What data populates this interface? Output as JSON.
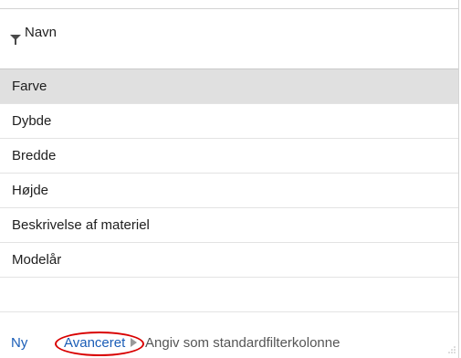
{
  "header": {
    "column_label": "Navn",
    "filter_icon": "filter-funnel-icon"
  },
  "list": {
    "items": [
      {
        "label": "Farve",
        "selected": true
      },
      {
        "label": "Dybde",
        "selected": false
      },
      {
        "label": "Bredde",
        "selected": false
      },
      {
        "label": "Højde",
        "selected": false
      },
      {
        "label": "Beskrivelse af materiel",
        "selected": false
      },
      {
        "label": "Modelår",
        "selected": false
      }
    ]
  },
  "footer": {
    "new_label": "Ny",
    "advanced_label": "Avanceret",
    "set_default_label": "Angiv som standardfilterkolonne",
    "advanced_icon": "triangle-arrow-icon"
  },
  "colors": {
    "link": "#1a5db7",
    "highlight": "#d90000",
    "selected_row": "#e0e0e0"
  }
}
